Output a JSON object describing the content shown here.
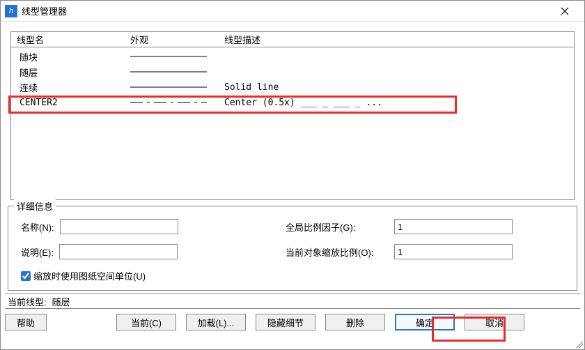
{
  "window": {
    "title": "线型管理器",
    "icon_glyph": "h",
    "close_tooltip": "Close"
  },
  "list": {
    "headers": {
      "name": "线型名",
      "appearance": "外观",
      "desc": "线型描述"
    },
    "rows": [
      {
        "name": "随块",
        "appearance": "solid",
        "desc": ""
      },
      {
        "name": "随层",
        "appearance": "solid",
        "desc": ""
      },
      {
        "name": "连续",
        "appearance": "solid",
        "desc": "Solid line"
      },
      {
        "name": "CENTER2",
        "appearance": "center2",
        "desc": "Center (0.5x) ___ _ ___ _ ..."
      }
    ],
    "highlight_row_index": 3
  },
  "details": {
    "legend": "详细信息",
    "name_label": "名称(N):",
    "name_value": "",
    "desc_label": "说明(E):",
    "desc_value": "",
    "global_label": "全局比例因子(G):",
    "global_value": "1",
    "current_scale_label": "当前对象缩放比例(O):",
    "current_scale_value": "1",
    "use_paper_label": "缩放时使用图纸空间单位(U)",
    "use_paper_checked": true
  },
  "current": {
    "label": "当前线型:",
    "value": "随层"
  },
  "buttons": {
    "help": "帮助",
    "current": "当前(C)",
    "load": "加载(L)...",
    "hide_detail": "隐藏细节",
    "delete": "删除",
    "ok": "确定",
    "cancel": "取消"
  }
}
